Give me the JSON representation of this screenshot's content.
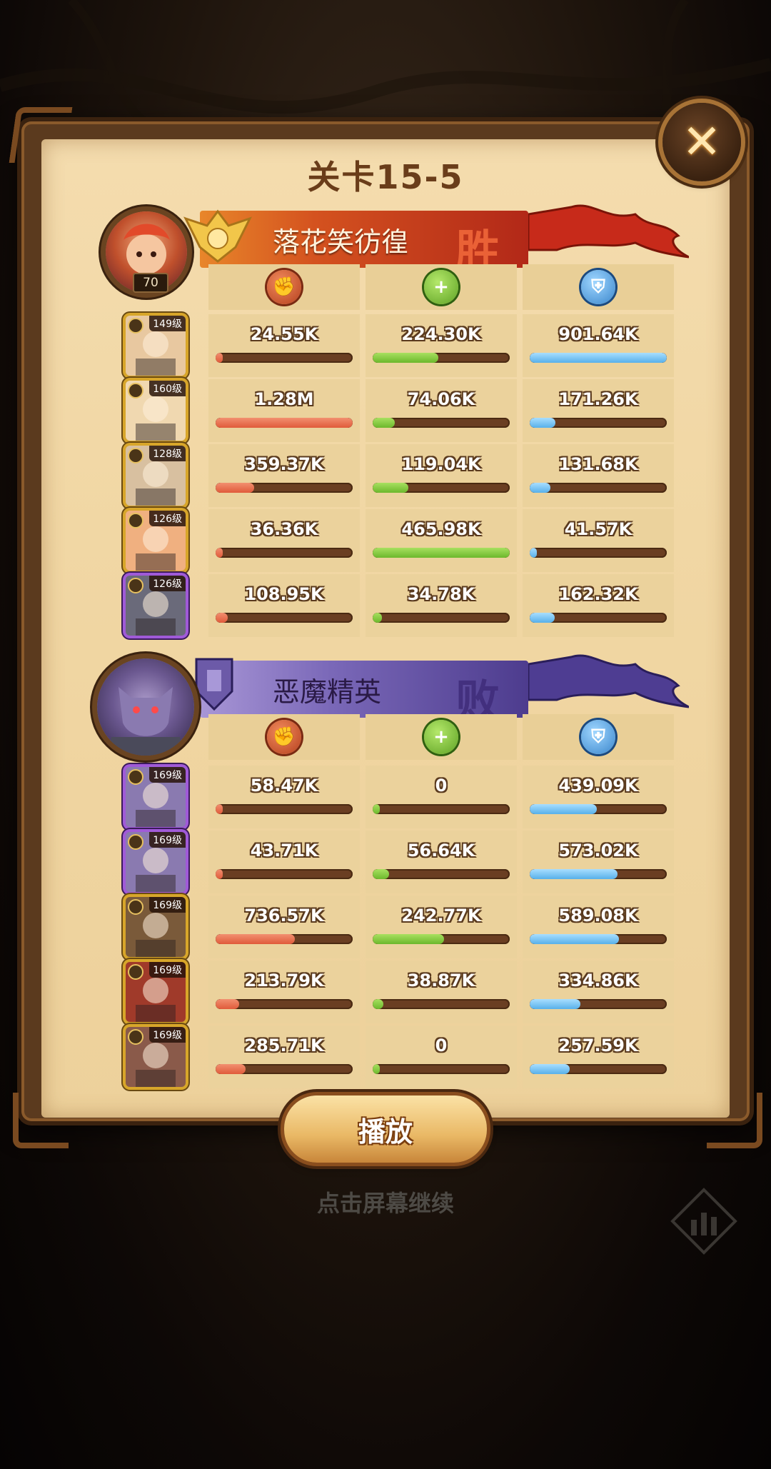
{
  "header": {
    "title": "关卡15-5",
    "close_icon": "close-icon"
  },
  "team_a": {
    "name": "落花笑彷徨",
    "result": "胜",
    "player_level": "70",
    "color": "#c8361c",
    "heroes": [
      {
        "level": "149级",
        "frame": "gold",
        "damage": "24.55K",
        "damage_pct": 0.02,
        "heal": "224.30K",
        "heal_pct": 0.48,
        "def": "901.64K",
        "def_pct": 1.0
      },
      {
        "level": "160级",
        "frame": "gold",
        "damage": "1.28M",
        "damage_pct": 1.0,
        "heal": "74.06K",
        "heal_pct": 0.16,
        "def": "171.26K",
        "def_pct": 0.19
      },
      {
        "level": "128级",
        "frame": "gold",
        "damage": "359.37K",
        "damage_pct": 0.28,
        "heal": "119.04K",
        "heal_pct": 0.26,
        "def": "131.68K",
        "def_pct": 0.15
      },
      {
        "level": "126级",
        "frame": "gold",
        "damage": "36.36K",
        "damage_pct": 0.03,
        "heal": "465.98K",
        "heal_pct": 1.0,
        "def": "41.57K",
        "def_pct": 0.05
      },
      {
        "level": "126级",
        "frame": "purple",
        "damage": "108.95K",
        "damage_pct": 0.09,
        "heal": "34.78K",
        "heal_pct": 0.07,
        "def": "162.32K",
        "def_pct": 0.18
      }
    ]
  },
  "team_b": {
    "name": "恶魔精英",
    "result": "败",
    "color": "#5b4a9e",
    "heroes": [
      {
        "level": "169级",
        "frame": "purple",
        "damage": "58.47K",
        "damage_pct": 0.05,
        "heal": "0",
        "heal_pct": 0.0,
        "def": "439.09K",
        "def_pct": 0.49
      },
      {
        "level": "169级",
        "frame": "purple",
        "damage": "43.71K",
        "damage_pct": 0.03,
        "heal": "56.64K",
        "heal_pct": 0.12,
        "def": "573.02K",
        "def_pct": 0.64
      },
      {
        "level": "169级",
        "frame": "gold",
        "damage": "736.57K",
        "damage_pct": 0.58,
        "heal": "242.77K",
        "heal_pct": 0.52,
        "def": "589.08K",
        "def_pct": 0.65
      },
      {
        "level": "169级",
        "frame": "gold",
        "damage": "213.79K",
        "damage_pct": 0.17,
        "heal": "38.87K",
        "heal_pct": 0.08,
        "def": "334.86K",
        "def_pct": 0.37
      },
      {
        "level": "169级",
        "frame": "gold",
        "damage": "285.71K",
        "damage_pct": 0.22,
        "heal": "0",
        "heal_pct": 0.0,
        "def": "257.59K",
        "def_pct": 0.29
      }
    ]
  },
  "stat_columns": [
    {
      "icon": "damage-icon",
      "color": "#e05a3a"
    },
    {
      "icon": "heal-icon",
      "color": "#6cb82c"
    },
    {
      "icon": "defense-icon",
      "color": "#58b0ea"
    }
  ],
  "footer": {
    "play_label": "播放",
    "hint": "点击屏幕继续",
    "stats_icon": "bar-chart-icon"
  }
}
